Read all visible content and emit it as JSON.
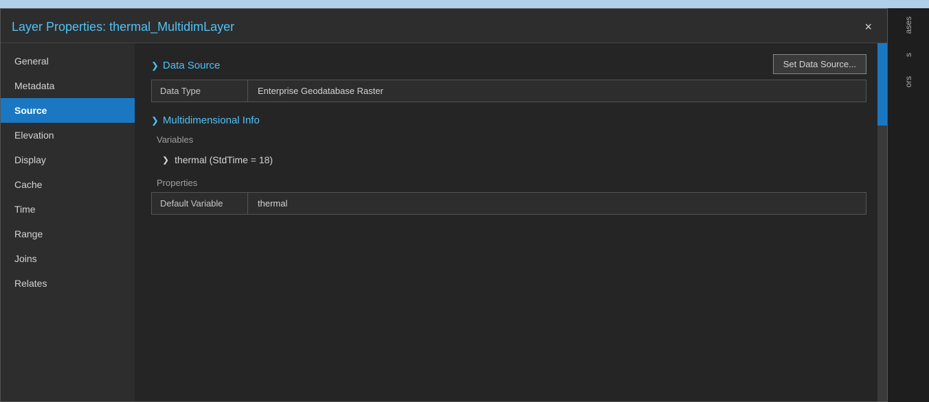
{
  "dialog": {
    "title": "Layer Properties: thermal_MultidimLayer",
    "close_label": "×"
  },
  "sidebar": {
    "items": [
      {
        "id": "general",
        "label": "General",
        "active": false
      },
      {
        "id": "metadata",
        "label": "Metadata",
        "active": false
      },
      {
        "id": "source",
        "label": "Source",
        "active": true
      },
      {
        "id": "elevation",
        "label": "Elevation",
        "active": false
      },
      {
        "id": "display",
        "label": "Display",
        "active": false
      },
      {
        "id": "cache",
        "label": "Cache",
        "active": false
      },
      {
        "id": "time",
        "label": "Time",
        "active": false
      },
      {
        "id": "range",
        "label": "Range",
        "active": false
      },
      {
        "id": "joins",
        "label": "Joins",
        "active": false
      },
      {
        "id": "relates",
        "label": "Relates",
        "active": false
      }
    ]
  },
  "content": {
    "set_datasource_btn": "Set Data Source...",
    "data_source_section": {
      "title": "Data Source",
      "chevron": "❯",
      "data_type_label": "Data Type",
      "data_type_value": "Enterprise Geodatabase Raster"
    },
    "multidim_section": {
      "title": "Multidimensional Info",
      "chevron": "❯",
      "variables_label": "Variables",
      "variable_expand_icon": "›",
      "variable_name": "thermal (StdTime = 18)",
      "properties_label": "Properties",
      "default_variable_label": "Default Variable",
      "default_variable_value": "thermal"
    }
  },
  "right_panel": {
    "items": [
      "ases",
      "s",
      "ors"
    ]
  }
}
